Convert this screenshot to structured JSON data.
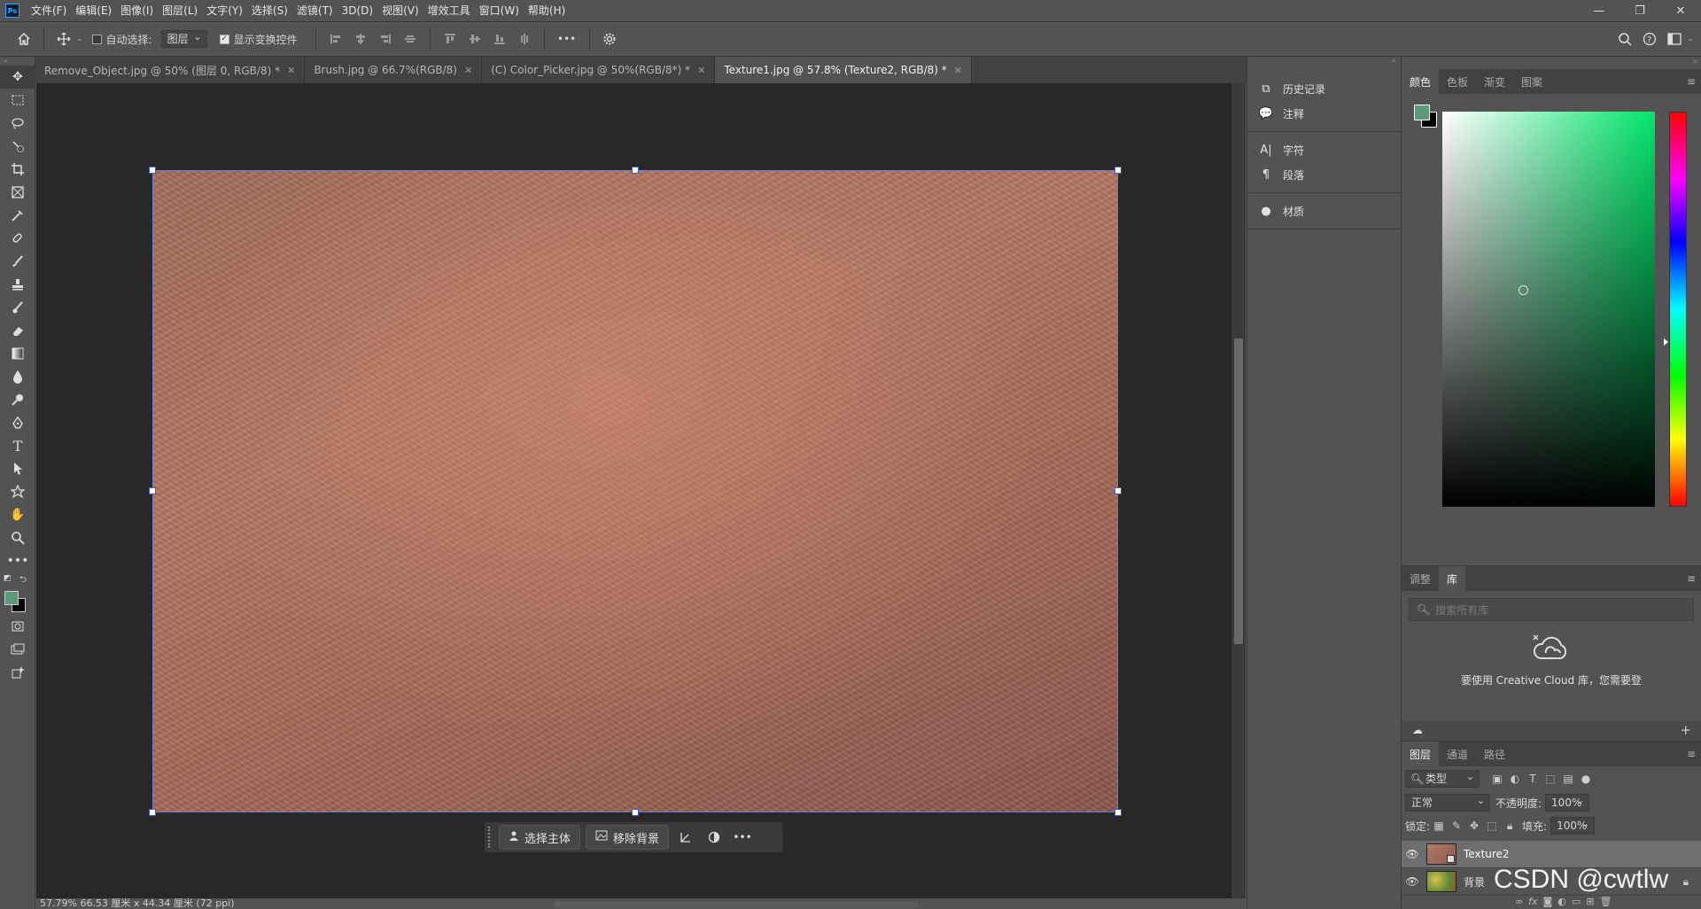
{
  "app": {
    "logo": "Ps"
  },
  "menu": [
    "文件(F)",
    "编辑(E)",
    "图像(I)",
    "图层(L)",
    "文字(Y)",
    "选择(S)",
    "滤镜(T)",
    "3D(D)",
    "视图(V)",
    "增效工具",
    "窗口(W)",
    "帮助(H)"
  ],
  "options": {
    "auto_select_label": "自动选择:",
    "auto_select_value": "图层",
    "show_transform_label": "显示变换控件",
    "show_transform_checked": true,
    "more": "•••"
  },
  "tabs": [
    {
      "label": "Remove_Object.jpg @ 50% (图层 0, RGB/8) *",
      "active": false
    },
    {
      "label": "Brush.jpg @ 66.7%(RGB/8)",
      "active": false
    },
    {
      "label": "(C) Color_Picker.jpg @ 50%(RGB/8*) *",
      "active": false
    },
    {
      "label": "Texture1.jpg @ 57.8% (Texture2, RGB/8) *",
      "active": true
    }
  ],
  "taskbar": {
    "select_subject": "选择主体",
    "remove_background": "移除背景",
    "more": "•••"
  },
  "statusbar": {
    "text": "57.79%   66.53 厘米 x 44.34 厘米 (72 ppi)"
  },
  "midpanel": {
    "history": "历史记录",
    "notes": "注释",
    "character": "字符",
    "paragraph": "段落",
    "materials": "材质"
  },
  "color_panel": {
    "tabs": [
      "颜色",
      "色板",
      "渐变",
      "图案"
    ],
    "fg_color": "#5a9a78",
    "bg_color": "#000000"
  },
  "libraries_panel": {
    "tabs": [
      "调整",
      "库"
    ],
    "search_placeholder": "搜索所有库",
    "message": "要使用 Creative Cloud 库，您需要登"
  },
  "layers_panel": {
    "tabs": [
      "图层",
      "通道",
      "路径"
    ],
    "filter_type": "类型",
    "blend_mode": "正常",
    "opacity_label": "不透明度:",
    "opacity_value": "100%",
    "lock_label": "锁定:",
    "fill_label": "填充:",
    "fill_value": "100%",
    "layers": [
      {
        "name": "Texture2",
        "selected": true,
        "locked": false
      },
      {
        "name": "背景",
        "selected": false,
        "locked": true
      }
    ]
  },
  "watermark": "CSDN @cwtlw"
}
